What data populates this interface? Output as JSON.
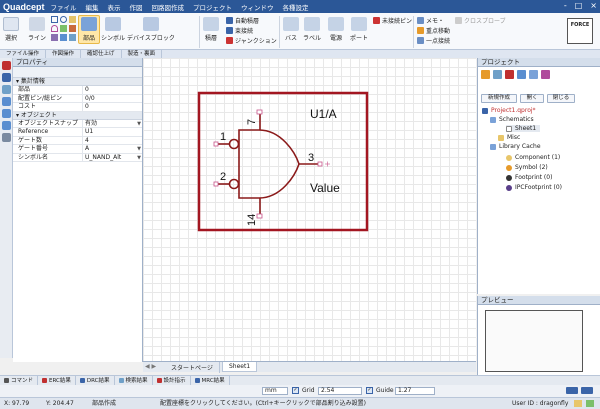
{
  "app": {
    "logo": "Quadcept"
  },
  "menu": [
    "ファイル",
    "編集",
    "表示",
    "作図",
    "回路図作成",
    "プロジェクト",
    "ウィンドウ",
    "各種設定"
  ],
  "window_controls": [
    "-",
    "□",
    "×"
  ],
  "ribbon": {
    "big": [
      "選択",
      "ライン",
      "部品",
      "シンボル",
      "デバイスブロック",
      "積層",
      "バス",
      "ラベル",
      "電源",
      "ポート"
    ],
    "small": [
      "自動積層",
      "束接続",
      "ジャンクション",
      "未接続ピン",
      "メモ・",
      "重点移動",
      "一点接続",
      "クロスプローブ"
    ],
    "force_label": "FORCE"
  },
  "ribbon_groups": [
    "ファイル操作",
    "作図操作",
    "確認仕上げ",
    "製造・裏面"
  ],
  "properties": {
    "title": "プロパティ",
    "sections": [
      {
        "name": "集計情報",
        "rows": [
          [
            "部品",
            "0"
          ],
          [
            "配置ピン/総ピン",
            "0/0"
          ],
          [
            "コスト",
            "0"
          ]
        ]
      },
      {
        "name": "オブジェクト",
        "rows": [
          [
            "オブジェクトスナップ",
            "有効"
          ],
          [
            "Reference",
            "U1"
          ],
          [
            "ゲート数",
            "4"
          ],
          [
            "ゲート番号",
            "A"
          ],
          [
            "シンボル名",
            "U_NAND_Alt"
          ]
        ]
      }
    ]
  },
  "symbol": {
    "ref": "U1/A",
    "value": "Value",
    "pins": {
      "in1": "1",
      "in2": "2",
      "out": "3",
      "vcc": "7",
      "gnd": "14"
    }
  },
  "doc_tabs": [
    "スタートページ",
    "Sheet1"
  ],
  "project": {
    "title": "プロジェクト",
    "buttons": [
      "新規作成",
      "開く",
      "閉じる"
    ],
    "tree": [
      "Project1.qproj*",
      "Schematics",
      "Sheet1",
      "Misc",
      "Library Cache",
      "Component (1)",
      "Symbol (2)",
      "Footprint (0)",
      "IPCFootprint (0)"
    ]
  },
  "preview": {
    "title": "プレビュー"
  },
  "bottom_tabs": [
    "コマンド",
    "ERC結果",
    "DRC結果",
    "検索結果",
    "設計指示",
    "MRC結果"
  ],
  "gridbar": {
    "unit": "mm",
    "grid_label": "Grid",
    "grid_value": "2.54",
    "guide_label": "Guide",
    "guide_value": "1.27"
  },
  "status": {
    "x": "X: 97.79",
    "y": "Y: 204.47",
    "mode": "部品作成",
    "message": "配置座標をクリックしてください。(Ctrl+キークリックで部品割り込み設置)",
    "user": "User ID : dragonfly"
  },
  "colors": {
    "title": "#2b5797",
    "frame": "#a31621",
    "gate": "#8b1a1a",
    "pinmarker": "#c8548a",
    "accent": "#e69a2a"
  }
}
